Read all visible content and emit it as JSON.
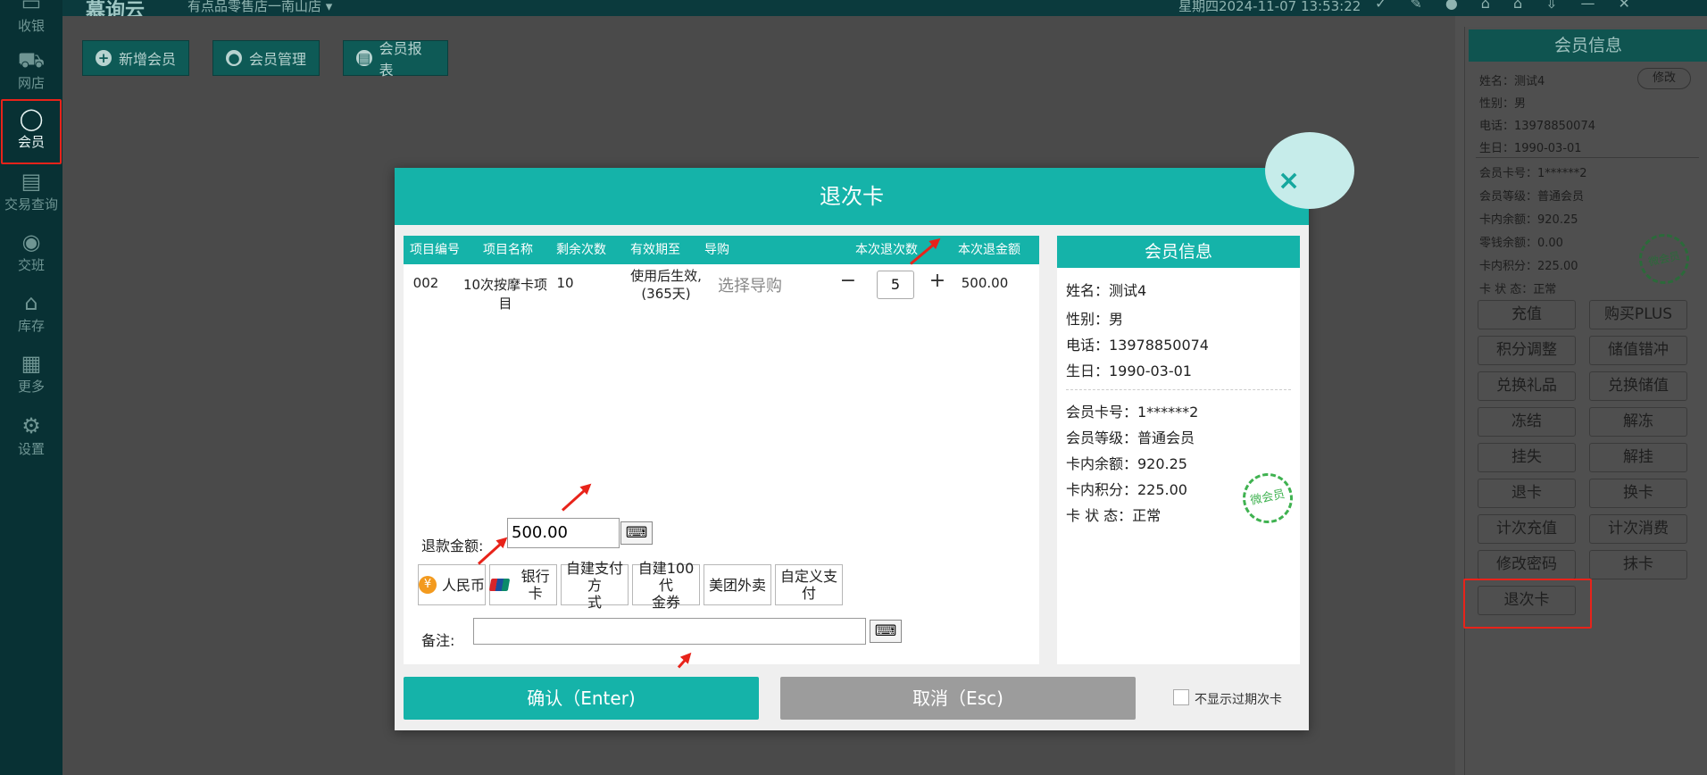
{
  "topbar": {
    "brand": "慕询云",
    "store": "有点品零售店一南山店 ▾",
    "clock": "星期四2024-11-07 13:53:22",
    "icons": [
      "✓",
      "✎",
      "●",
      "⌂",
      "⌂",
      "⇩",
      "—",
      "✕"
    ]
  },
  "nav": {
    "items": [
      {
        "icon": "▭",
        "label": "收银"
      },
      {
        "icon": "⛟",
        "label": "网店"
      },
      {
        "icon": "◯",
        "label": "会员"
      },
      {
        "icon": "▤",
        "label": "交易查询"
      },
      {
        "icon": "◉",
        "label": "交班"
      },
      {
        "icon": "⌂",
        "label": "库存"
      },
      {
        "icon": "▦",
        "label": "更多"
      },
      {
        "icon": "⚙",
        "label": "设置"
      }
    ]
  },
  "toolbar": {
    "add_member": "新增会员",
    "member_manage": "会员管理",
    "member_report": "会员报表",
    "add_icon": "+",
    "person_icon": "●",
    "report_icon": "▤"
  },
  "side": {
    "title": "会员信息",
    "edit": "修改",
    "name": "姓名：测试4",
    "gender": "性别：男",
    "phone": "电话：13978850074",
    "birthday": "生日：1990-03-01",
    "card_no": "会员卡号：1******2",
    "level": "会员等级：普通会员",
    "balance": "卡内余额：920.25",
    "change": "零钱余额：0.00",
    "points": "卡内积分：225.00",
    "status": "卡 状 态：正常",
    "stamp": "微会员",
    "buttons": [
      "充值",
      "购买PLUS",
      "积分调整",
      "储值错冲",
      "兑换礼品",
      "兑换储值",
      "冻结",
      "解冻",
      "挂失",
      "解挂",
      "退卡",
      "换卡",
      "计次充值",
      "计次消费",
      "修改密码",
      "抹卡",
      "退次卡"
    ]
  },
  "modal": {
    "title": "退次卡",
    "close": "×",
    "columns": [
      "项目编号",
      "项目名称",
      "剩余次数",
      "有效期至",
      "导购",
      "本次退次数",
      "本次退金额"
    ],
    "row": {
      "code": "002",
      "name": "10次按摩卡项目",
      "remaining": "10",
      "validity_1": "使用后生效,",
      "validity_2": "(365天)",
      "guide": "选择导购",
      "minus": "−",
      "count": "5",
      "plus": "+",
      "amount": "500.00"
    },
    "refund_label": "退款金额:",
    "refund_value": "500.00",
    "keyboard": "⌨",
    "pay_methods": [
      {
        "label": "人民币",
        "icon": "¥"
      },
      {
        "label": "银行卡"
      },
      {
        "label_1": "自建支付方",
        "label_2": "式"
      },
      {
        "label_1": "自建100代",
        "label_2": "金券"
      },
      {
        "label": "美团外卖"
      },
      {
        "label": "自定义支付"
      }
    ],
    "note_label": "备注:",
    "confirm": "确认（Enter)",
    "cancel": "取消（Esc)",
    "hide_expired": "不显示过期次卡",
    "info": {
      "title": "会员信息",
      "name": "姓名：测试4",
      "gender": "性别：男",
      "phone": "电话：13978850074",
      "birthday": "生日：1990-03-01",
      "card_no": "会员卡号：1******2",
      "level": "会员等级：普通会员",
      "balance": "卡内余额：920.25",
      "points": "卡内积分：225.00",
      "status": "卡 状 态：正常",
      "stamp": "微会员"
    }
  },
  "colors": {
    "accent": "#15b3a9",
    "annotation": "#e8231a",
    "cancel": "#9c9c9c"
  }
}
